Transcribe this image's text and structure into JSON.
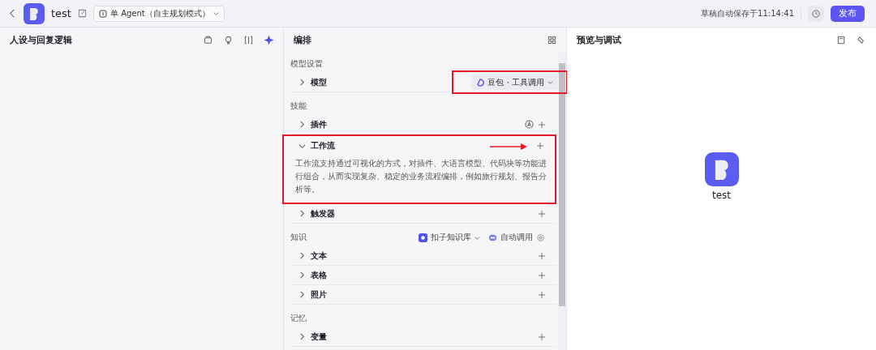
{
  "header": {
    "bot_name": "test",
    "mode": "单 Agent（自主规划模式）",
    "save_status": "草稿自动保存于11:14:41",
    "publish": "发布"
  },
  "persona_panel": {
    "title": "人设与回复逻辑"
  },
  "arrange_panel": {
    "title": "编排",
    "sections": [
      {
        "title": "模型设置",
        "rows": [
          {
            "kind": "model",
            "label": "模型",
            "expanded": false,
            "value": "豆包 · 工具调用",
            "highlighted": true
          }
        ]
      },
      {
        "title": "技能",
        "rows": [
          {
            "kind": "plugin",
            "label": "插件",
            "expanded": false
          },
          {
            "kind": "plain",
            "label": "工作流",
            "expanded": true,
            "highlighted": true,
            "arrow": true,
            "description": "工作流支持通过可视化的方式，对插件、大语言模型、代码块等功能进行组合，从而实现复杂、稳定的业务流程编排，例如旅行规划、报告分析等。"
          },
          {
            "kind": "plain",
            "label": "触发器",
            "expanded": false
          }
        ]
      },
      {
        "title": "知识",
        "extras": [
          {
            "kind": "source",
            "label": "扣子知识库"
          },
          {
            "kind": "auto",
            "label": "自动调用"
          }
        ],
        "rows": [
          {
            "kind": "plain",
            "label": "文本",
            "expanded": false
          },
          {
            "kind": "plain",
            "label": "表格",
            "expanded": false
          },
          {
            "kind": "plain",
            "label": "照片",
            "expanded": false
          }
        ]
      },
      {
        "title": "记忆",
        "rows": [
          {
            "kind": "plain",
            "label": "变量",
            "expanded": false
          }
        ]
      }
    ]
  },
  "preview_panel": {
    "title": "预览与调试",
    "bot_name": "test"
  }
}
